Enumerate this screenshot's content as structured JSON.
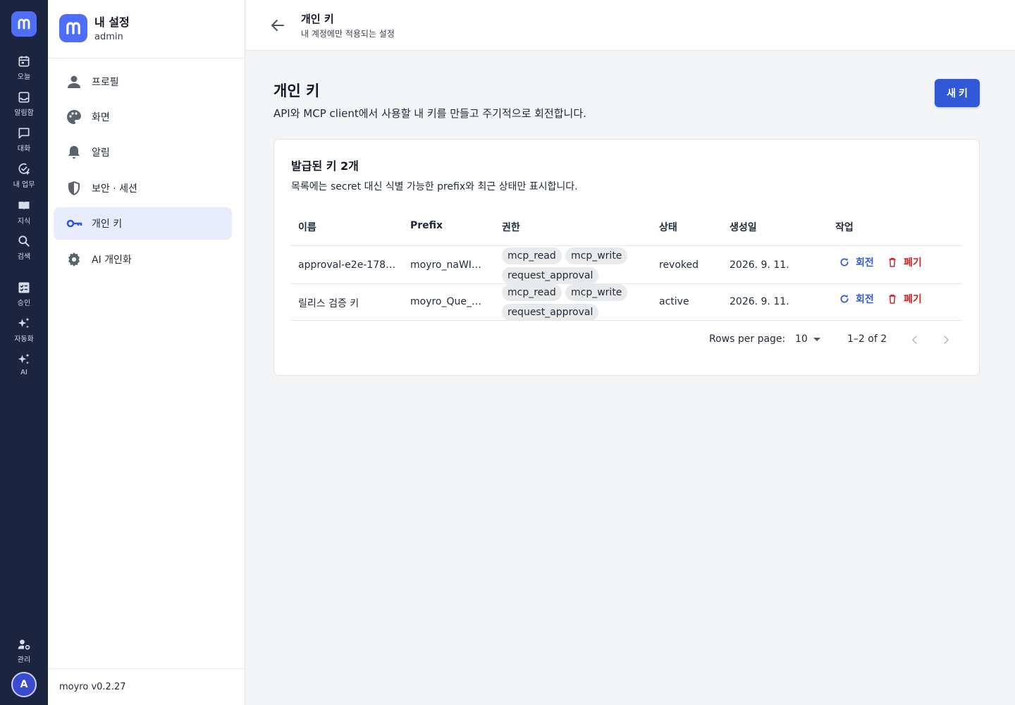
{
  "rail": {
    "logo_letter": "m",
    "items": [
      {
        "label": "오늘",
        "icon": "calendar-icon"
      },
      {
        "label": "알림함",
        "icon": "inbox-icon"
      },
      {
        "label": "대화",
        "icon": "chat-icon"
      },
      {
        "label": "내 업무",
        "icon": "task-check-icon"
      },
      {
        "label": "지식",
        "icon": "book-icon"
      },
      {
        "label": "검색",
        "icon": "search-icon"
      },
      {
        "label": "승인",
        "icon": "approval-icon"
      },
      {
        "label": "자동화",
        "icon": "sparkle-icon"
      },
      {
        "label": "AI",
        "icon": "ai-sparkle-icon"
      },
      {
        "label": "관리",
        "icon": "admin-icon"
      }
    ],
    "avatar": "A"
  },
  "sidebar": {
    "title": "내 설정",
    "subtitle": "admin",
    "items": [
      {
        "label": "프로필",
        "icon": "person-icon"
      },
      {
        "label": "화면",
        "icon": "palette-icon"
      },
      {
        "label": "알림",
        "icon": "bell-icon"
      },
      {
        "label": "보안 · 세션",
        "icon": "shield-icon"
      },
      {
        "label": "개인 키",
        "icon": "key-icon",
        "active": true
      },
      {
        "label": "AI 개인화",
        "icon": "ai-settings-icon"
      }
    ],
    "version": "moyro v0.2.27"
  },
  "topbar": {
    "title": "개인 키",
    "subtitle": "내 계정에만 적용되는 설정"
  },
  "main": {
    "title": "개인 키",
    "description": "API와 MCP client에서 사용할 내 키를 만들고 주기적으로 회전합니다.",
    "new_button": "새 키"
  },
  "card": {
    "title": "발급된 키 2개",
    "description": "목록에는 secret 대신 식별 가능한 prefix와 최근 상태만 표시합니다.",
    "columns": [
      "이름",
      "Prefix",
      "권한",
      "상태",
      "생성일",
      "작업"
    ],
    "rows": [
      {
        "name": "approval-e2e-178…",
        "prefix": "moyro_naWI…",
        "scopes": [
          "mcp_read",
          "mcp_write",
          "request_approval"
        ],
        "status": "revoked",
        "created": "2026. 9. 11.",
        "rotate": "회전",
        "revoke": "폐기"
      },
      {
        "name": "릴리스 검증 키",
        "prefix": "moyro_Que_…",
        "scopes": [
          "mcp_read",
          "mcp_write",
          "request_approval"
        ],
        "status": "active",
        "created": "2026. 9. 11.",
        "rotate": "회전",
        "revoke": "폐기"
      }
    ],
    "pagination": {
      "rows_per_page_label": "Rows per page:",
      "rows_per_page": "10",
      "range": "1–2 of 2"
    }
  },
  "colors": {
    "rail_bg": "#1b2540",
    "brand": "#4f6ef7",
    "primary": "#2f57d6",
    "danger": "#c62828",
    "active_nav_bg": "#e8ecfb"
  }
}
